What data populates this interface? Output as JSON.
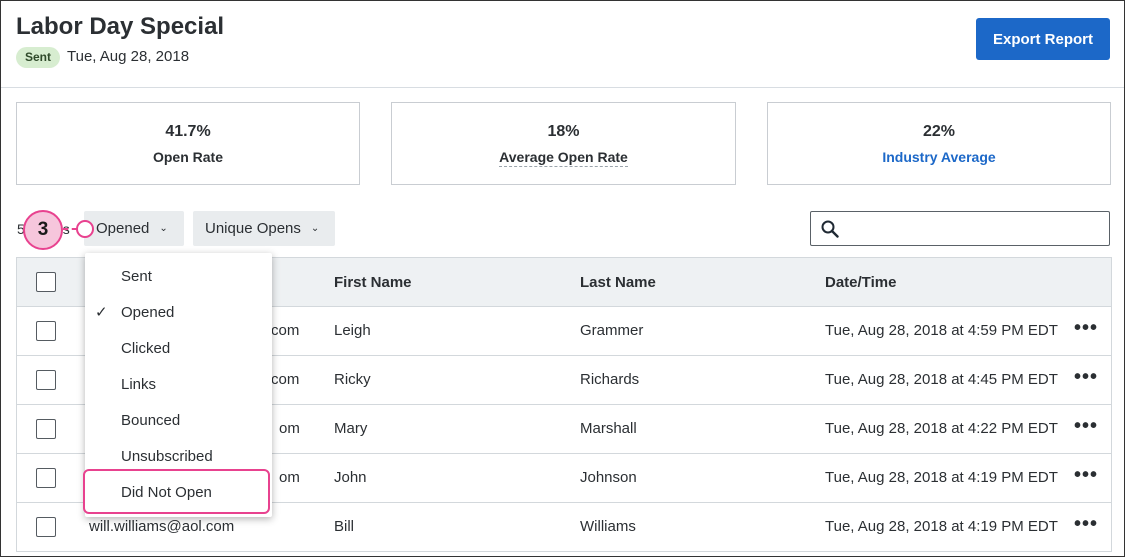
{
  "header": {
    "title": "Labor Day Special",
    "status_badge": "Sent",
    "sent_date": "Tue, Aug 28, 2018",
    "export_label": "Export Report"
  },
  "stats": [
    {
      "value": "41.7%",
      "label": "Open Rate"
    },
    {
      "value": "18%",
      "label": "Average Open Rate"
    },
    {
      "value": "22%",
      "label": "Industry Average"
    }
  ],
  "toolbar": {
    "count_prefix": "5",
    "count_suffix": "s",
    "filter_label": "Opened",
    "opens_label": "Unique Opens",
    "search_placeholder": "",
    "callout_number": "3"
  },
  "table": {
    "headers": [
      "First Name",
      "Last Name",
      "Date/Time"
    ],
    "rows": [
      {
        "email": "com",
        "first": "Leigh",
        "last": "Grammer",
        "datetime": "Tue, Aug 28, 2018 at 4:59 PM EDT"
      },
      {
        "email": "com",
        "first": "Ricky",
        "last": "Richards",
        "datetime": "Tue, Aug 28, 2018 at 4:45 PM EDT"
      },
      {
        "email": "om",
        "first": "Mary",
        "last": "Marshall",
        "datetime": "Tue, Aug 28, 2018 at 4:22 PM EDT"
      },
      {
        "email": "om",
        "first": "John",
        "last": "Johnson",
        "datetime": "Tue, Aug 28, 2018 at 4:19 PM EDT"
      },
      {
        "email": "will.williams@aol.com",
        "first": "Bill",
        "last": "Williams",
        "datetime": "Tue, Aug 28, 2018 at 4:19 PM EDT"
      }
    ],
    "more_label": "•••"
  },
  "dropdown": {
    "items": [
      "Sent",
      "Opened",
      "Clicked",
      "Links",
      "Bounced",
      "Unsubscribed",
      "Did Not Open"
    ],
    "check_mark": "✓"
  },
  "colors": {
    "accent": "#1c68c8",
    "badge_bg": "#d7edd0",
    "callout": "#e8428f"
  }
}
